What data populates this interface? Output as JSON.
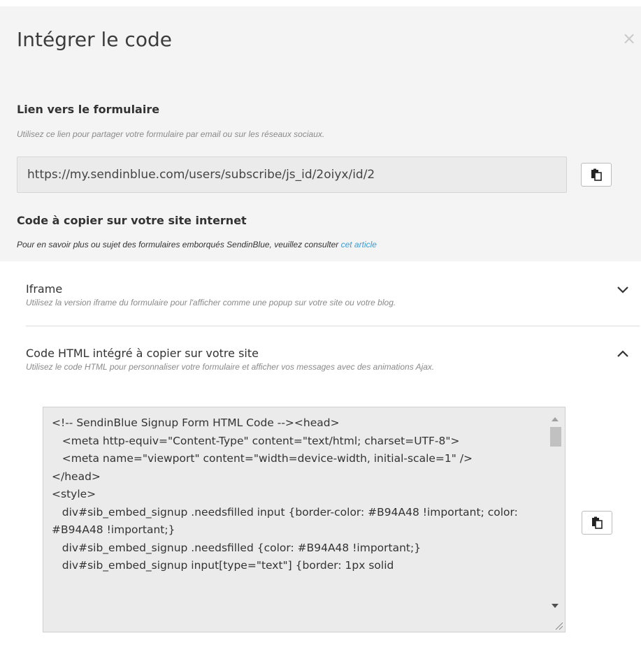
{
  "modal": {
    "title": "Intégrer le code",
    "close_symbol": "×"
  },
  "form_link": {
    "title": "Lien vers le formulaire",
    "description": "Utilisez ce lien pour partager votre formulaire par email ou sur les réseaux sociaux.",
    "url": "https://my.sendinblue.com/users/subscribe/js_id/2oiyx/id/2",
    "copy_icon": "clipboard-icon"
  },
  "site_code": {
    "title": "Code à copier sur votre site internet",
    "description": "Pour en savoir plus ou sujet des formulaires emborqués SendinBlue, veuillez consulter ",
    "link_text": "cet article"
  },
  "accordion": {
    "items": [
      {
        "title": "Iframe",
        "description": "Utilisez la version iframe du formulaire pour l'afficher comme une popup sur votre site ou votre blog.",
        "state": "collapsed",
        "chevron": "chevron-down-icon"
      },
      {
        "title": "Code HTML intégré à copier sur votre site",
        "description": "Utilisez le code HTML pour personnaliser votre formulaire et afficher vos messages avec des animations Ajax.",
        "state": "expanded",
        "chevron": "chevron-up-icon"
      }
    ]
  },
  "html_code": "<!-- SendinBlue Signup Form HTML Code --><head>\n   <meta http-equiv=\"Content-Type\" content=\"text/html; charset=UTF-8\">\n   <meta name=\"viewport\" content=\"width=device-width, initial-scale=1\" />\n</head>\n<style>\n   div#sib_embed_signup .needsfilled input {border-color: #B94A48 !important; color: #B94A48 !important;}\n   div#sib_embed_signup .needsfilled {color: #B94A48 !important;}\n   div#sib_embed_signup input[type=\"text\"] {border: 1px solid",
  "colors": {
    "modal_bg": "#f4f4f4",
    "panel_bg": "#ffffff",
    "link": "#3d9bd2",
    "input_bg": "#ebebeb"
  }
}
